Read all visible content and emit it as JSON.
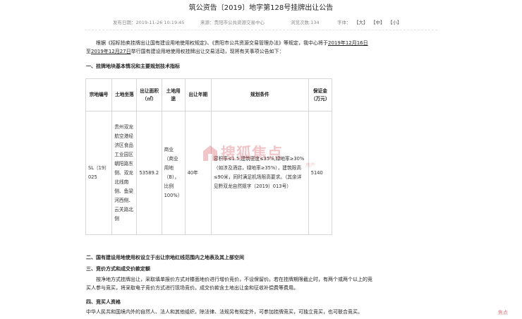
{
  "title": "筑公资告〔2019〕地字第128号挂牌出让公告",
  "meta": {
    "publish_date": "发布日期：2019-11-26 10:19:45",
    "source": "来源：贵阳市公共资源交易中心",
    "views": "浏览次数:134",
    "font_label": "字体：",
    "font_large": "【大】",
    "font_medium": "【中】",
    "font_small": "【小】"
  },
  "intro": {
    "line1_a": "根据《招标拍卖挂牌出让国有建设用地使用权规定》、《贵阳市公共资源交易管理办法》等规定，我中心将于",
    "line1_date": "2019年12月16日",
    "line2_prefix": "至",
    "line2_date": "2019年12月27日",
    "line2_b": "举行国有建设用地使用权挂牌出让交易活动，现将有关事项公告如下："
  },
  "sections": {
    "s1": "一、挂牌地块基本情况和主要规划技术指标",
    "s2": "二、国有建设用地使用权设立于出让宗地红线范围内之地表及其上部空间",
    "s3": "三、竞价方式和成交价款定额",
    "s3_text_1": "按净地方式挂牌出让，采取填单报价方式对楼面地价进行增价竞价，不设保留价。若在挂牌期限截止时，有两个或两个以上的竞",
    "s3_text_2": "买人参与竞买，将采取电子竞价方式进行现场竞价。成交价款含土地出让金和征收补偿费等费用。",
    "s4": "四、竞买人资格",
    "s4_text": "中华人民共和国境内外的自然人、法人和其他组织，除法律、法规另有规定外，可参加挂牌竞买，可独立竞买，也可联合竞买。"
  },
  "table": {
    "headers": {
      "code": "宗地编号",
      "location": "土地坐落",
      "area": "出让面积（㎡）",
      "use": "土地用途",
      "term": "出让年期",
      "conditions": "规划条件",
      "deposit": "保证金（万元）"
    },
    "row": {
      "code": "SL〔19〕025",
      "location": "贵州双龙航空港经济区食品工业园区朝阳路东侧、双龙北线南侧、鱼梁河西侧、云关路北侧",
      "area": "53589.2",
      "use": "商业（商业用地（B），比例100%）",
      "term": "40年",
      "conditions": "容积率≤1.5,建筑密度≤35%,绿地率≥30%（如涉及酒店，绿地率≥35%），建筑限高≤90米，同时满足机场限高要求。（其余详见黔双龙自然规字〔2019〕013号）",
      "deposit": "5140"
    }
  },
  "watermark": {
    "text": "搜狐焦点",
    "sub": "房产"
  },
  "corner_logo": "焦点"
}
